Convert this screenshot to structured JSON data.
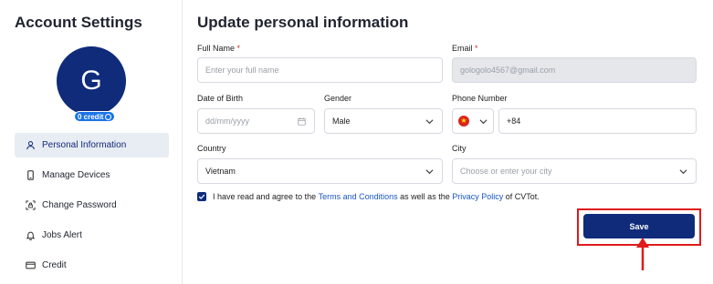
{
  "sidebar": {
    "title": "Account Settings",
    "avatar_initial": "G",
    "credit_badge": "0 credit",
    "items": [
      {
        "label": "Personal Information",
        "icon": "user-icon"
      },
      {
        "label": "Manage Devices",
        "icon": "phone-icon"
      },
      {
        "label": "Change Password",
        "icon": "lock-scan-icon"
      },
      {
        "label": "Jobs Alert",
        "icon": "bell-icon"
      },
      {
        "label": "Credit",
        "icon": "card-icon"
      }
    ]
  },
  "main": {
    "title": "Update personal information",
    "full_name": {
      "label": "Full Name",
      "required": "*",
      "placeholder": "Enter your full name"
    },
    "email": {
      "label": "Email",
      "required": "*",
      "value": "gologolo4567@gmail.com"
    },
    "dob": {
      "label": "Date of Birth",
      "placeholder": "dd/mm/yyyy"
    },
    "gender": {
      "label": "Gender",
      "value": "Male"
    },
    "phone": {
      "label": "Phone Number",
      "value": "+84"
    },
    "country": {
      "label": "Country",
      "value": "Vietnam"
    },
    "city": {
      "label": "City",
      "placeholder": "Choose or enter your city"
    },
    "agree": {
      "text1": "I have read and agree to the",
      "terms_link": "Terms and Conditions",
      "text2": "as well as the",
      "privacy_link": "Privacy Policy",
      "text3": "of CVTot."
    },
    "save_label": "Save"
  },
  "colors": {
    "primary": "#0f2b7a",
    "link": "#1a56c4",
    "highlight": "#e0191b"
  }
}
